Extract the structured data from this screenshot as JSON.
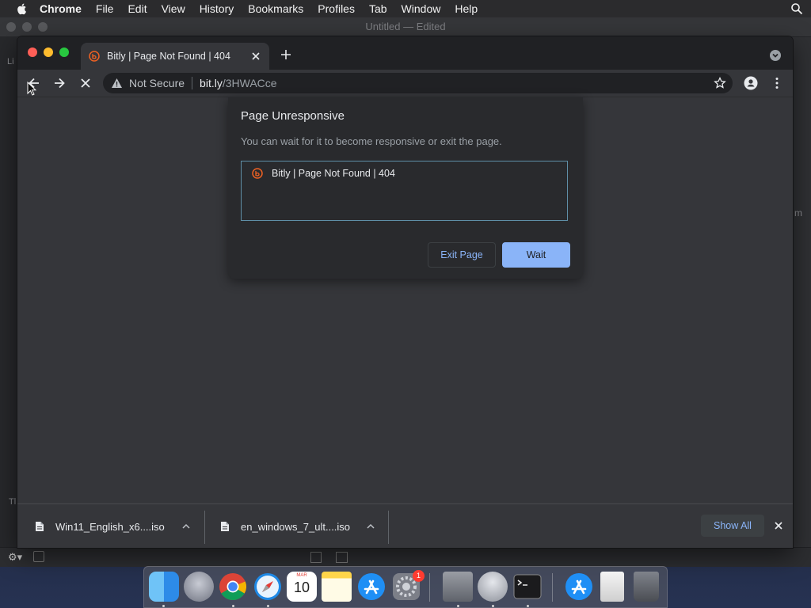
{
  "menubar": {
    "app_name": "Chrome",
    "items": [
      "File",
      "Edit",
      "View",
      "History",
      "Bookmarks",
      "Profiles",
      "Tab",
      "Window",
      "Help"
    ]
  },
  "background_window": {
    "title": "Untitled — Edited",
    "edge_glyphs": [
      "Li",
      "m",
      "Tl"
    ]
  },
  "chrome": {
    "tab": {
      "title": "Bitly | Page Not Found | 404",
      "favicon": "bitly-icon"
    },
    "omnibox": {
      "security_label": "Not Secure",
      "host": "bit.ly",
      "path": "/3HWACce"
    }
  },
  "dialog": {
    "title": "Page Unresponsive",
    "message": "You can wait for it to become responsive or exit the page.",
    "pages": [
      {
        "title": "Bitly | Page Not Found | 404"
      }
    ],
    "exit_label": "Exit Page",
    "wait_label": "Wait"
  },
  "downloads": {
    "items": [
      {
        "filename": "Win11_English_x6....iso"
      },
      {
        "filename": "en_windows_7_ult....iso"
      }
    ],
    "show_all_label": "Show All"
  },
  "dock": {
    "apps": [
      "finder",
      "launchpad",
      "chrome",
      "safari",
      "calendar",
      "notes",
      "app-store",
      "system-preferences",
      "utility-archive",
      "automator",
      "terminal",
      "app-store-2",
      "file",
      "trash"
    ],
    "calendar_month": "MAR",
    "calendar_day": "10",
    "system_preferences_badge": "1"
  },
  "colors": {
    "accent_blue": "#8ab4f8",
    "tab_strip": "#202124",
    "toolbar": "#35363a",
    "dialog_bg": "#292a2d",
    "traffic_red": "#ff5f57",
    "traffic_yellow": "#febc2e",
    "traffic_green": "#28c840"
  }
}
